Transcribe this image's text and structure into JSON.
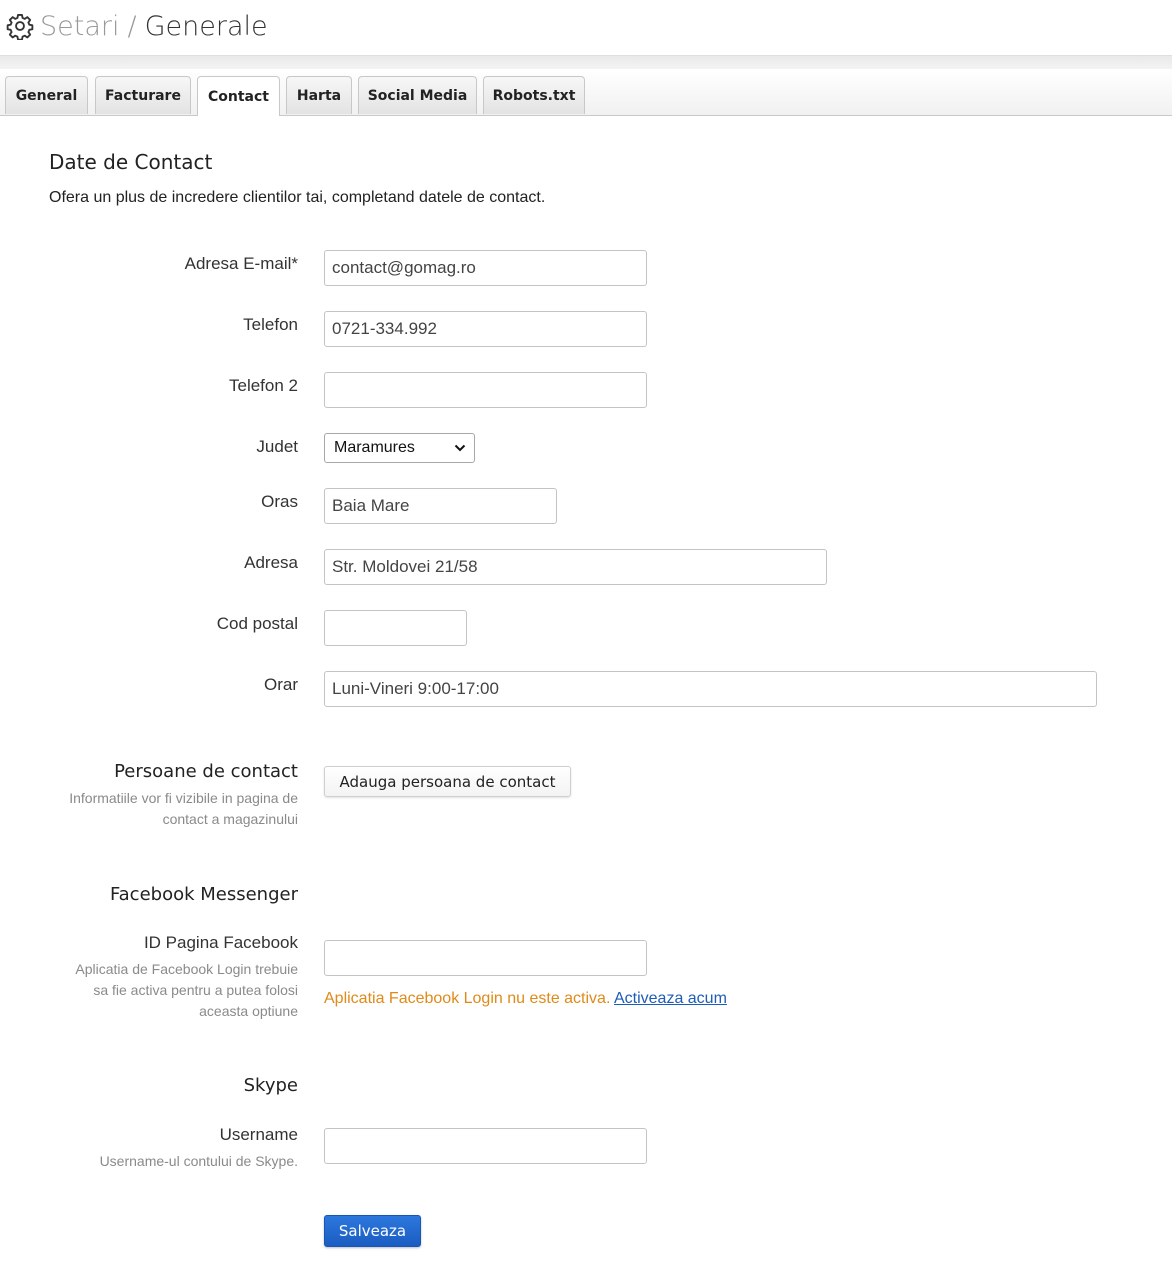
{
  "header": {
    "root": "Setari",
    "separator": "/",
    "current": "Generale"
  },
  "tabs": [
    {
      "label": "General"
    },
    {
      "label": "Facturare"
    },
    {
      "label": "Contact"
    },
    {
      "label": "Harta"
    },
    {
      "label": "Social Media"
    },
    {
      "label": "Robots.txt"
    }
  ],
  "active_tab": "Contact",
  "section": {
    "title": "Date de Contact",
    "intro": "Ofera un plus de incredere clientilor tai, completand datele de contact."
  },
  "fields": {
    "email": {
      "label": "Adresa E-mail*",
      "value": "contact@gomag.ro"
    },
    "phone": {
      "label": "Telefon",
      "value": "0721-334.992"
    },
    "phone2": {
      "label": "Telefon 2",
      "value": ""
    },
    "county": {
      "label": "Judet",
      "value": "Maramures"
    },
    "city": {
      "label": "Oras",
      "value": "Baia Mare"
    },
    "address": {
      "label": "Adresa",
      "value": "Str. Moldovei 21/58"
    },
    "postal": {
      "label": "Cod postal",
      "value": ""
    },
    "schedule": {
      "label": "Orar",
      "value": "Luni-Vineri 9:00-17:00"
    }
  },
  "contacts": {
    "title": "Persoane de contact",
    "help_line1": "Informatiile vor fi vizibile in pagina de",
    "help_line2": "contact a magazinului",
    "add_button": "Adauga persoana de contact"
  },
  "facebook": {
    "title": "Facebook Messenger",
    "label": "ID Pagina Facebook",
    "help_line1": "Aplicatia de Facebook Login trebuie",
    "help_line2": "sa fie activa pentru a putea folosi",
    "help_line3": "aceasta optiune",
    "value": "",
    "warning": "Aplicatia Facebook Login nu este activa.",
    "link": "Activeaza acum"
  },
  "skype": {
    "title": "Skype",
    "label": "Username",
    "help": "Username-ul contului de Skype.",
    "value": ""
  },
  "save_button": "Salveaza",
  "colors": {
    "primary": "#1b5dc2",
    "warning": "#e08a18",
    "link": "#1d5db8"
  }
}
